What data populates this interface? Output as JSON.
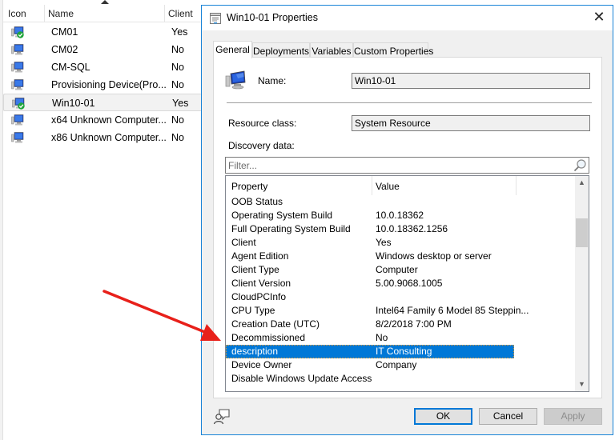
{
  "list": {
    "columns": [
      "Icon",
      "Name",
      "Client"
    ],
    "rows": [
      {
        "name": "CM01",
        "client": "Yes",
        "icon": "computer-client-icon"
      },
      {
        "name": "CM02",
        "client": "No",
        "icon": "computer-icon"
      },
      {
        "name": "CM-SQL",
        "client": "No",
        "icon": "computer-icon"
      },
      {
        "name": "Provisioning Device(Pro...",
        "client": "No",
        "icon": "computer-icon"
      },
      {
        "name": "Win10-01",
        "client": "Yes",
        "icon": "computer-client-icon",
        "selected": true
      },
      {
        "name": "x64 Unknown Computer...",
        "client": "No",
        "icon": "computer-icon"
      },
      {
        "name": "x86 Unknown Computer...",
        "client": "No",
        "icon": "computer-icon"
      }
    ]
  },
  "dialog": {
    "title": "Win10-01 Properties",
    "close_label": "✕",
    "tabs": [
      {
        "label": "General",
        "active": true
      },
      {
        "label": "Deployments"
      },
      {
        "label": "Variables"
      },
      {
        "label": "Custom Properties"
      }
    ],
    "general": {
      "name_label": "Name:",
      "name_value": "Win10-01",
      "resource_class_label": "Resource class:",
      "resource_class_value": "System Resource",
      "discovery_label": "Discovery data:",
      "filter_placeholder": "Filter...",
      "table": {
        "columns": [
          "Property",
          "Value"
        ],
        "rows": [
          {
            "property": "OOB Status",
            "value": ""
          },
          {
            "property": "Operating System Build",
            "value": "10.0.18362"
          },
          {
            "property": "Full Operating System Build",
            "value": "10.0.18362.1256"
          },
          {
            "property": "Client",
            "value": "Yes"
          },
          {
            "property": "Agent Edition",
            "value": "Windows desktop or server"
          },
          {
            "property": "Client Type",
            "value": "Computer"
          },
          {
            "property": "Client Version",
            "value": "5.00.9068.1005"
          },
          {
            "property": "CloudPCInfo",
            "value": ""
          },
          {
            "property": "CPU Type",
            "value": "Intel64 Family 6 Model 85 Steppin..."
          },
          {
            "property": "Creation Date (UTC)",
            "value": "8/2/2018 7:00 PM"
          },
          {
            "property": "Decommissioned",
            "value": "No"
          },
          {
            "property": "description",
            "value": "IT Consulting",
            "selected": true
          },
          {
            "property": "Device Owner",
            "value": "Company"
          },
          {
            "property": "Disable Windows Update Access",
            "value": ""
          }
        ],
        "scroll_position": 0.18
      }
    },
    "buttons": {
      "ok": "OK",
      "cancel": "Cancel",
      "apply": "Apply"
    }
  },
  "colors": {
    "selection": "#0078d7",
    "dialog_border": "#1883d7",
    "annotation_arrow": "#e8201a"
  }
}
